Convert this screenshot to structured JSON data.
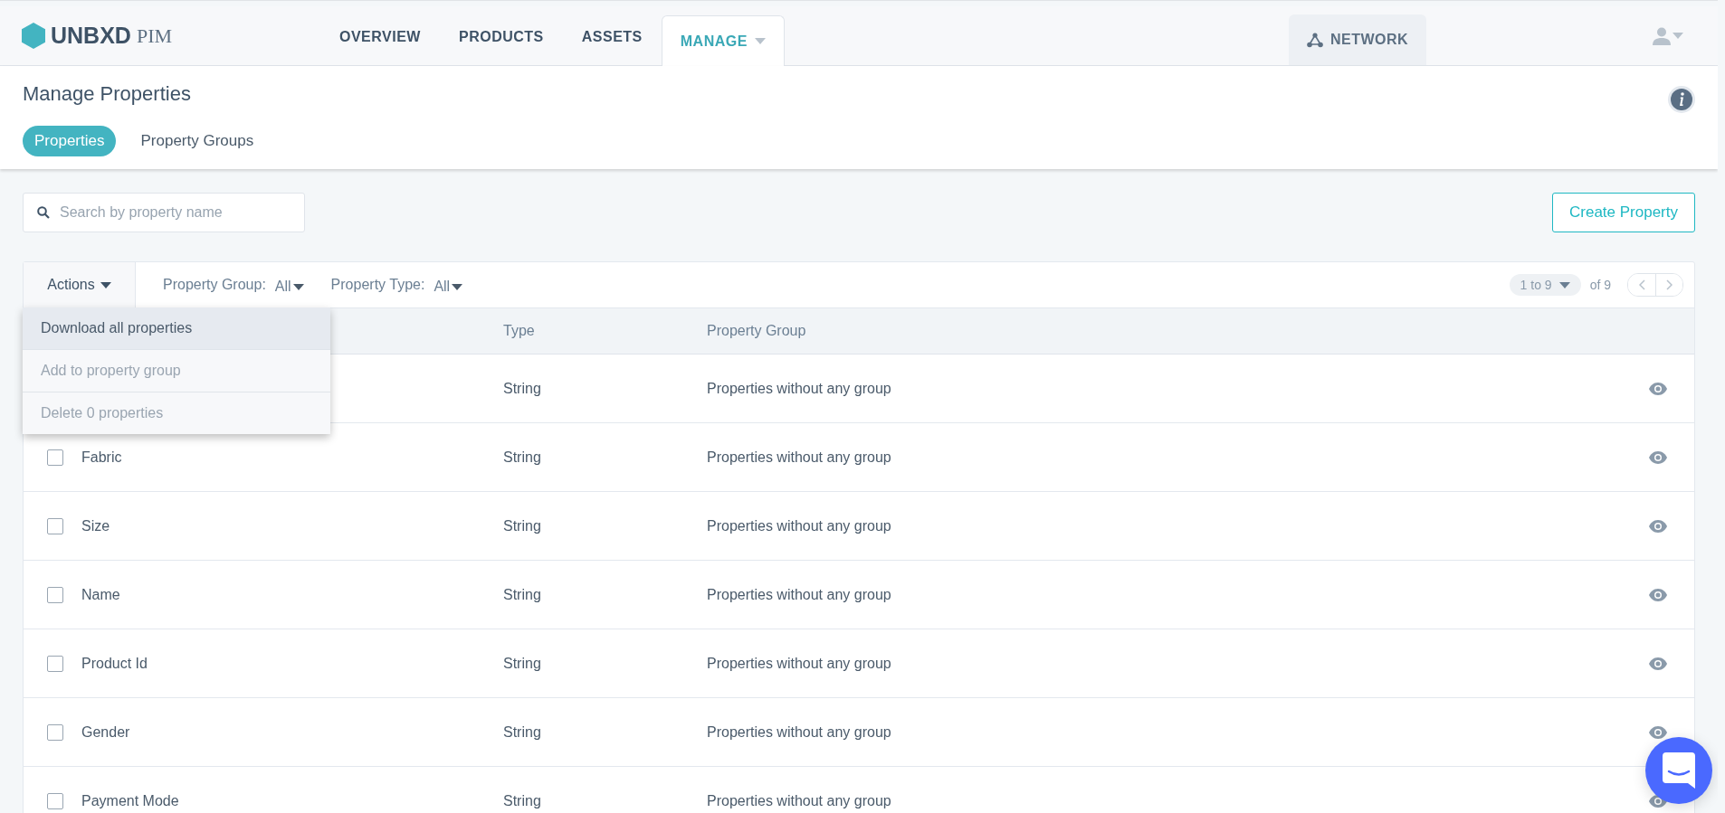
{
  "brand": {
    "name": "UNBXD",
    "product": "PIM"
  },
  "nav": [
    {
      "label": "OVERVIEW",
      "selected": false,
      "dropdown": false
    },
    {
      "label": "PRODUCTS",
      "selected": false,
      "dropdown": false
    },
    {
      "label": "ASSETS",
      "selected": false,
      "dropdown": false
    },
    {
      "label": "MANAGE",
      "selected": true,
      "dropdown": true
    }
  ],
  "network": {
    "label": "NETWORK"
  },
  "page": {
    "title": "Manage Properties"
  },
  "subtabs": [
    {
      "label": "Properties",
      "selected": true
    },
    {
      "label": "Property Groups",
      "selected": false
    }
  ],
  "search": {
    "placeholder": "Search by property name"
  },
  "create_button": "Create Property",
  "toolbar": {
    "actions": "Actions",
    "filters": [
      {
        "label": "Property Group:",
        "value": "All"
      },
      {
        "label": "Property Type:",
        "value": "All"
      }
    ],
    "range": "1 to 9",
    "total": "of 9"
  },
  "actions_menu": [
    {
      "label": "Download all properties",
      "disabled": false,
      "highlighted": true
    },
    {
      "label": "Add to property group",
      "disabled": true,
      "highlighted": false
    },
    {
      "label": "Delete 0 properties",
      "disabled": true,
      "highlighted": false
    }
  ],
  "table": {
    "columns": [
      "Type",
      "Property Group"
    ],
    "rows": [
      {
        "type": "String",
        "group": "Properties without any group"
      },
      {
        "name": "Fabric",
        "type": "String",
        "group": "Properties without any group",
        "checked": false
      },
      {
        "name": "Size",
        "type": "String",
        "group": "Properties without any group",
        "checked": false
      },
      {
        "name": "Name",
        "type": "String",
        "group": "Properties without any group",
        "checked": false
      },
      {
        "name": "Product Id",
        "type": "String",
        "group": "Properties without any group",
        "checked": false
      },
      {
        "name": "Gender",
        "type": "String",
        "group": "Properties without any group",
        "checked": false
      },
      {
        "name": "Payment Mode",
        "type": "String",
        "group": "Properties without any group",
        "checked": false
      }
    ]
  }
}
